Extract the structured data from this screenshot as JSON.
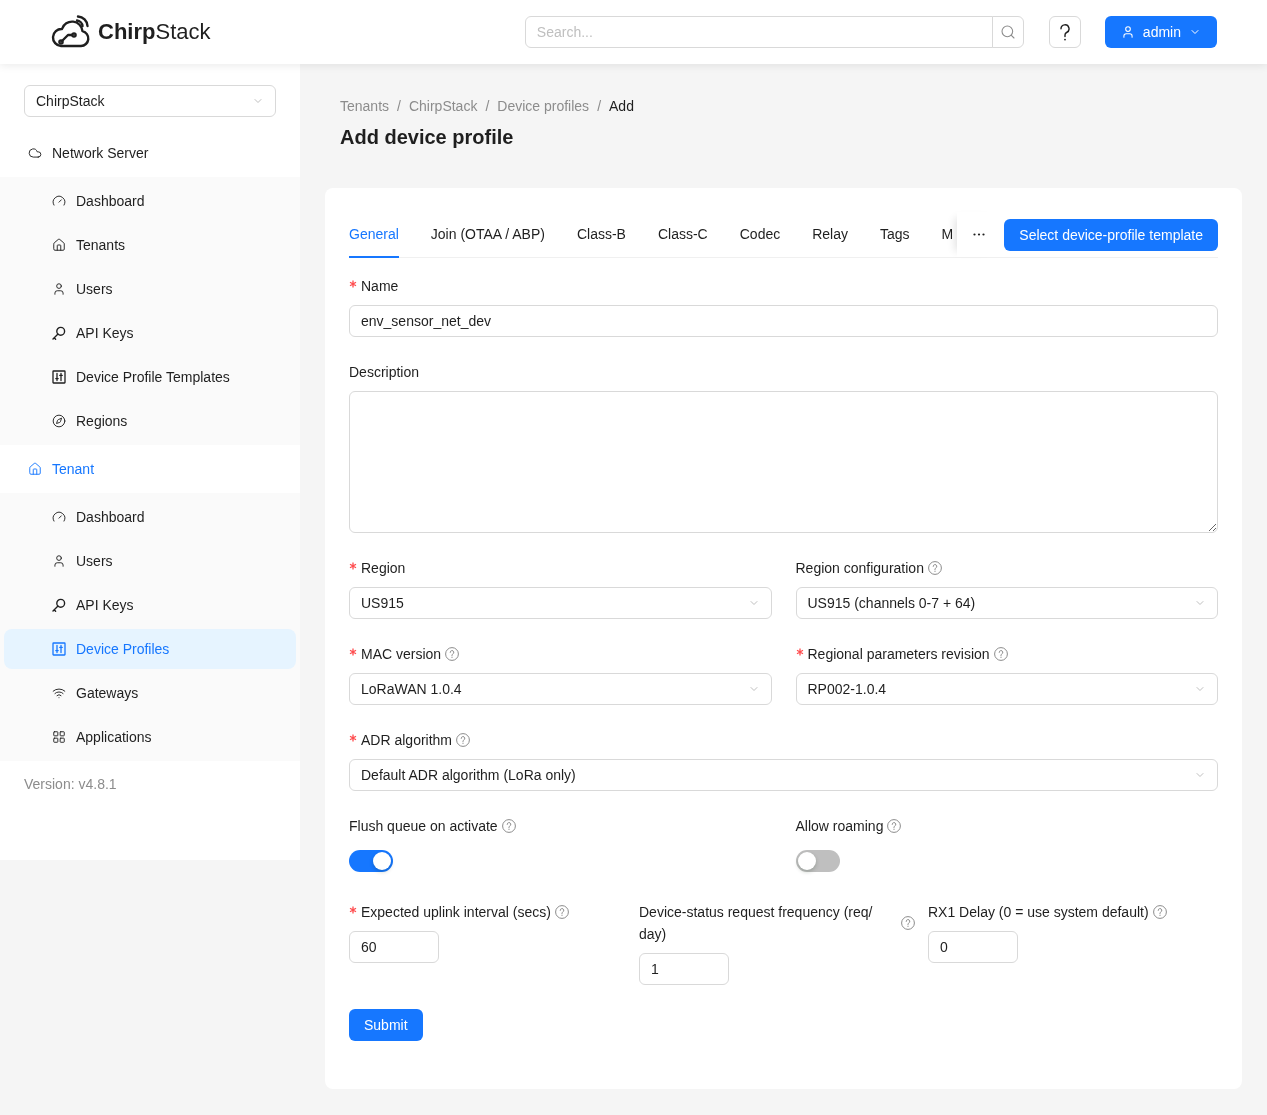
{
  "header": {
    "logo": "**Chirp**Stack",
    "search": {
      "placeholder": "Search..."
    },
    "user_menu": {
      "label": "admin"
    }
  },
  "sidebar": {
    "tenant_select": {
      "value": "ChirpStack"
    },
    "sections": [
      {
        "label": "Network Server",
        "kind": "server",
        "selected": false,
        "items": [
          {
            "label": "Dashboard",
            "kind": "dashboard",
            "selected": false
          },
          {
            "label": "Tenants",
            "kind": "tenants",
            "selected": false
          },
          {
            "label": "Users",
            "kind": "users",
            "selected": false
          },
          {
            "label": "API Keys",
            "kind": "keys",
            "selected": false
          },
          {
            "label": "Device Profile Templates",
            "kind": "profiles",
            "selected": false
          },
          {
            "label": "Regions",
            "kind": "regions",
            "selected": false
          }
        ]
      },
      {
        "label": "Tenant",
        "kind": "tenant",
        "selected": true,
        "items": [
          {
            "label": "Dashboard",
            "kind": "dashboard",
            "selected": false
          },
          {
            "label": "Users",
            "kind": "users",
            "selected": false
          },
          {
            "label": "API Keys",
            "kind": "keys",
            "selected": false
          },
          {
            "label": "Device Profiles",
            "kind": "profiles",
            "selected": true
          },
          {
            "label": "Gateways",
            "kind": "gateways",
            "selected": false
          },
          {
            "label": "Applications",
            "kind": "applications",
            "selected": false
          }
        ]
      }
    ],
    "version": "Version: v4.8.1"
  },
  "breadcrumb": {
    "separator": "/",
    "items": [
      {
        "label": "Tenants",
        "current": false
      },
      {
        "label": "ChirpStack",
        "current": false
      },
      {
        "label": "Device profiles",
        "current": false
      },
      {
        "label": "Add",
        "current": true
      }
    ]
  },
  "page_title": "Add device profile",
  "tabs": [
    {
      "label": "General",
      "selected": true
    },
    {
      "label": "Join (OTAA / ABP)",
      "selected": false
    },
    {
      "label": "Class-B",
      "selected": false
    },
    {
      "label": "Class-C",
      "selected": false
    },
    {
      "label": "Codec",
      "selected": false
    },
    {
      "label": "Relay",
      "selected": false
    },
    {
      "label": "Tags",
      "selected": false
    },
    {
      "label": "M",
      "selected": false
    }
  ],
  "template_button": "Select device-profile template",
  "form": {
    "rows": [
      [
        {
          "kind": "input",
          "label": "Name",
          "required": true,
          "help": false,
          "value": "env_sensor_net_dev"
        }
      ],
      [
        {
          "kind": "textarea",
          "label": "Description",
          "required": false,
          "help": false
        }
      ],
      [
        {
          "kind": "select",
          "label": "Region",
          "required": true,
          "help": false,
          "value": "US915"
        },
        {
          "kind": "select",
          "label": "Region configuration",
          "required": false,
          "help": true,
          "value": "US915 (channels 0-7 + 64)"
        }
      ],
      [
        {
          "kind": "select",
          "label": "MAC version",
          "required": true,
          "help": true,
          "value": "LoRaWAN 1.0.4"
        },
        {
          "kind": "select",
          "label": "Regional parameters revision",
          "required": true,
          "help": true,
          "value": "RP002-1.0.4"
        }
      ],
      [
        {
          "kind": "select",
          "label": "ADR algorithm",
          "required": true,
          "help": true,
          "value": "Default ADR algorithm (LoRa only)"
        }
      ],
      [
        {
          "kind": "switch",
          "label": "Flush queue on activate",
          "required": false,
          "help": true,
          "on": true
        },
        {
          "kind": "switch",
          "label": "Allow roaming",
          "required": false,
          "help": true,
          "on": false
        }
      ],
      [
        {
          "kind": "number",
          "label": "Expected uplink interval (secs)",
          "required": true,
          "help": true,
          "value": "60"
        },
        {
          "kind": "number",
          "label": "Device-status request frequency (req/day)",
          "required": false,
          "help": true,
          "value": "1"
        },
        {
          "kind": "number",
          "label": "RX1 Delay (0 = use system default)",
          "required": false,
          "help": true,
          "value": "0"
        }
      ]
    ],
    "submit": "Submit"
  }
}
